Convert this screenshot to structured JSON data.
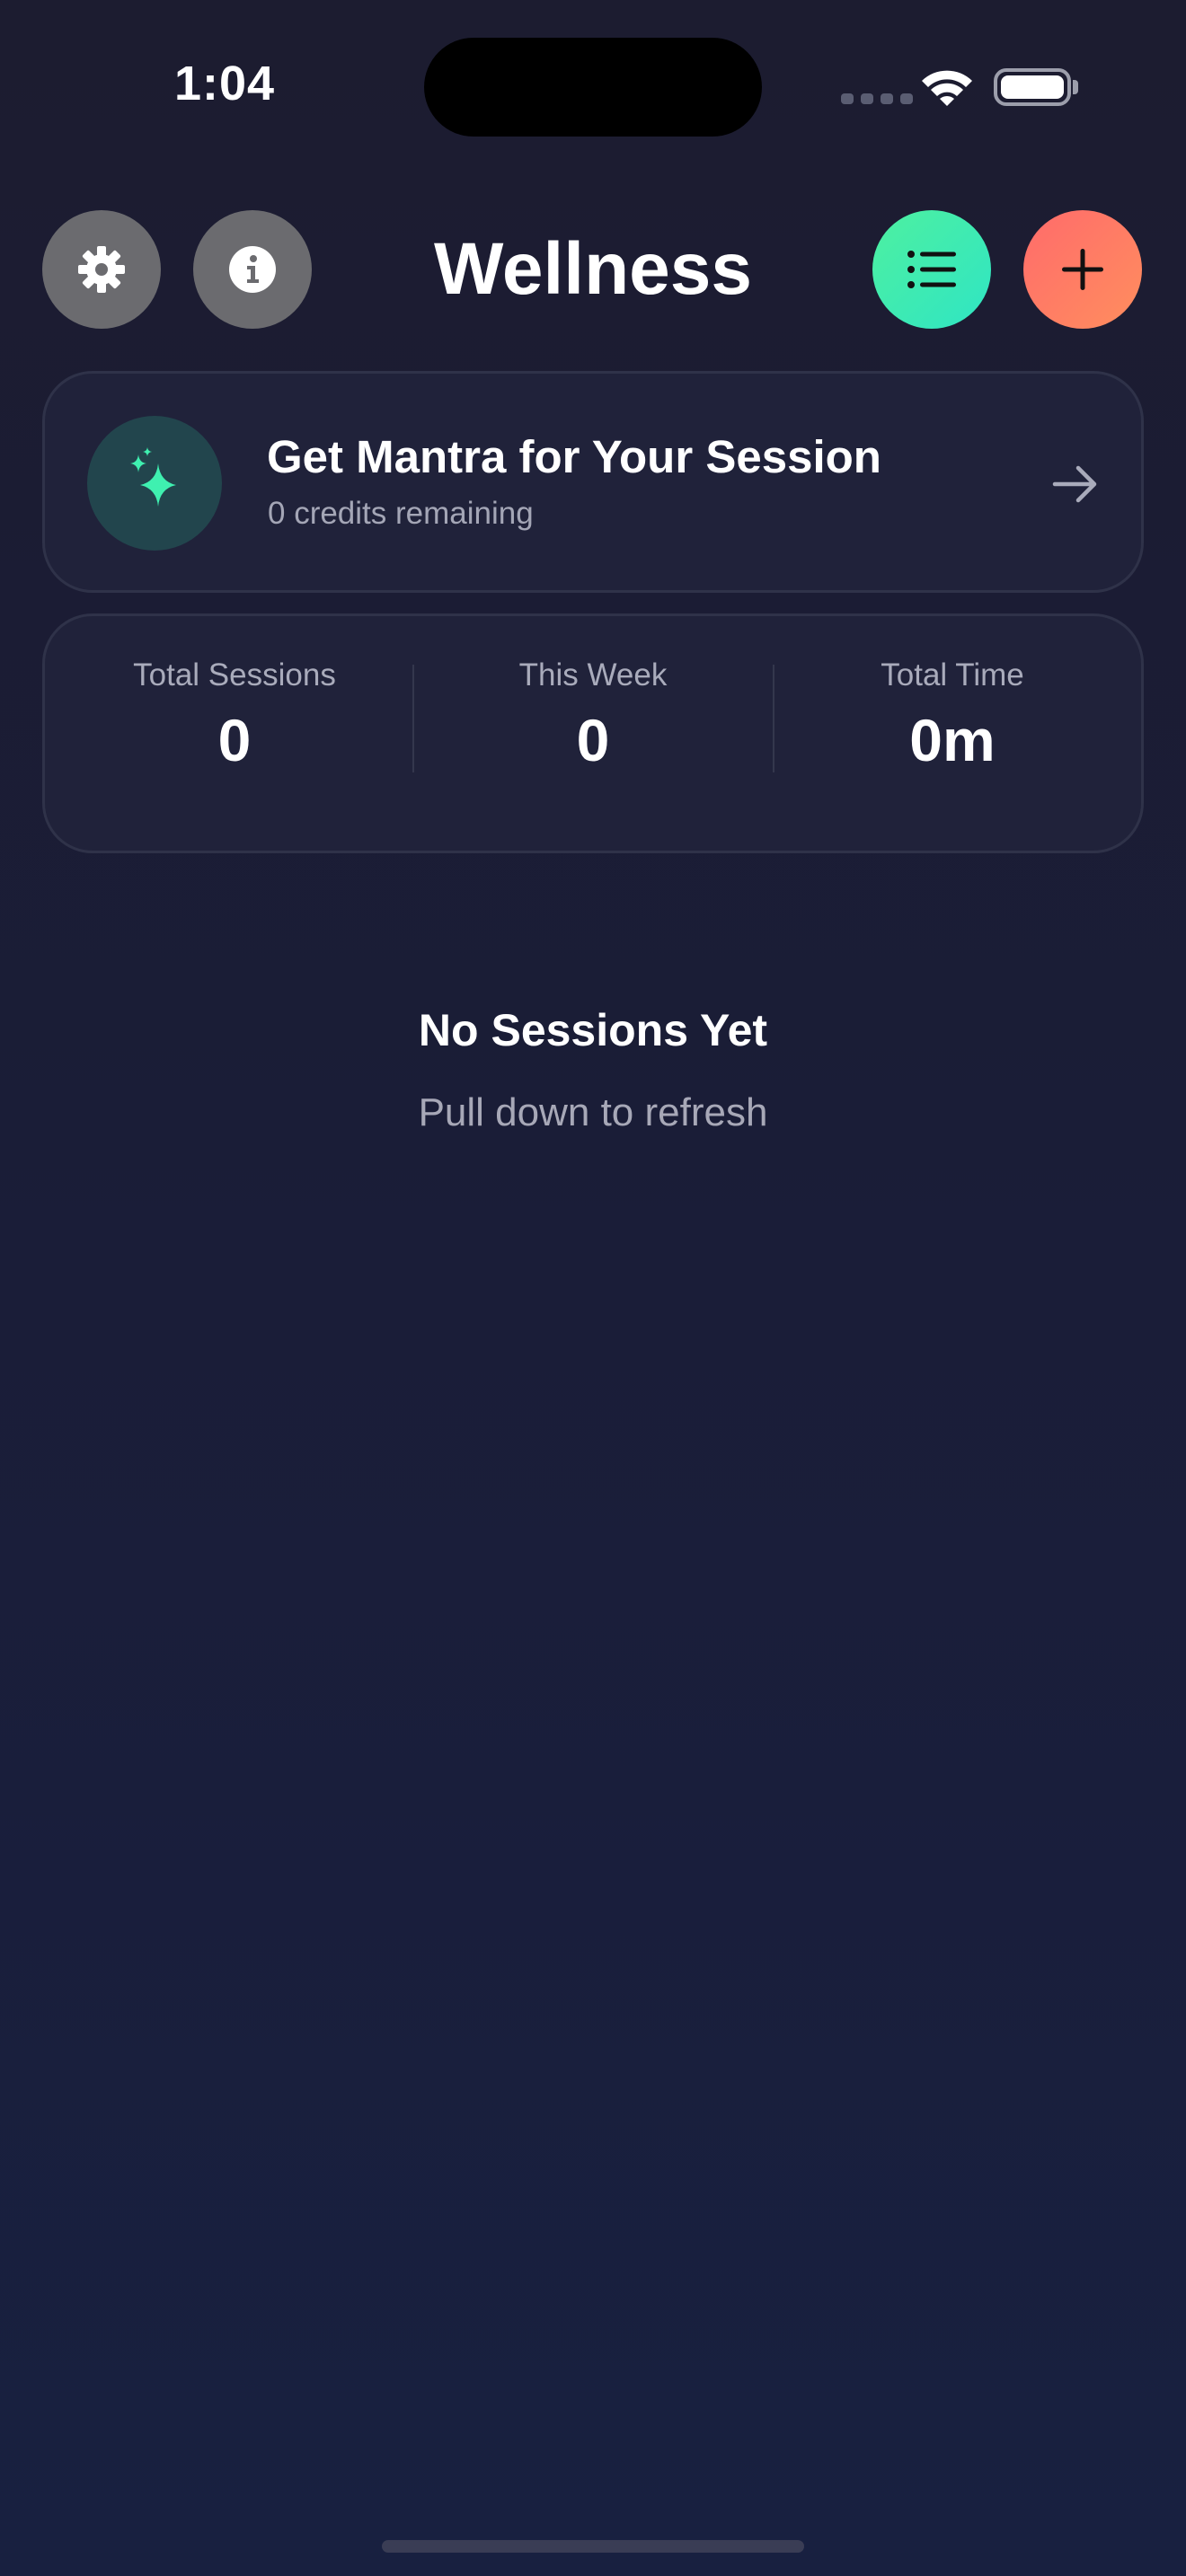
{
  "status_bar": {
    "time": "1:04"
  },
  "header": {
    "title": "Wellness",
    "buttons": {
      "settings": "gear-icon",
      "info": "info-icon",
      "list": "list-icon",
      "add": "plus-icon"
    }
  },
  "mantra_card": {
    "title": "Get Mantra for Your Session",
    "subtitle": "0 credits remaining",
    "icon": "sparkles-icon"
  },
  "stats": {
    "total_sessions": {
      "label": "Total Sessions",
      "value": "0"
    },
    "this_week": {
      "label": "This Week",
      "value": "0"
    },
    "total_time": {
      "label": "Total Time",
      "value": "0m"
    }
  },
  "empty_state": {
    "title": "No Sessions Yet",
    "subtitle": "Pull down to refresh"
  },
  "colors": {
    "background": "#1b1e36",
    "card": "#20223a",
    "accent_green": "#3ff0b0",
    "accent_coral": "#ff7a62",
    "neutral_button": "#6b6b6f"
  }
}
